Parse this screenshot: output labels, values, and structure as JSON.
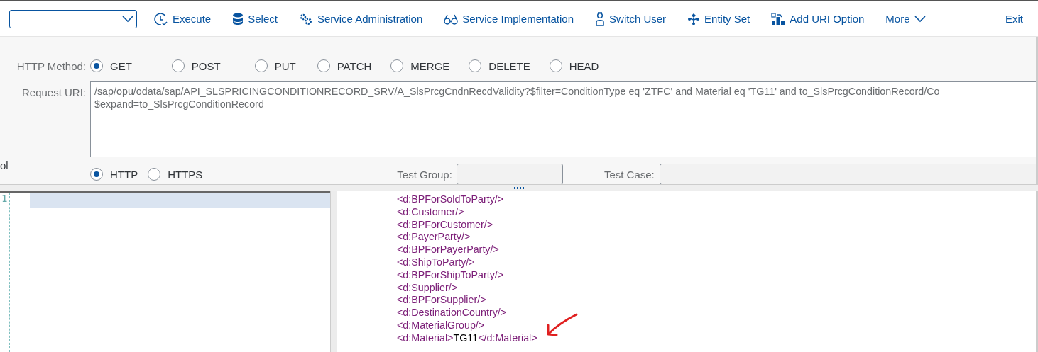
{
  "toolbar": {
    "items": [
      {
        "label": "Execute",
        "kind": "clock"
      },
      {
        "label": "Select",
        "kind": "database"
      },
      {
        "label": "Service Administration",
        "kind": "gears"
      },
      {
        "label": "Service Implementation",
        "kind": "glasses"
      },
      {
        "label": "Switch User",
        "kind": "person"
      },
      {
        "label": "Entity Set",
        "kind": "hierarchy"
      },
      {
        "label": "Add URI Option",
        "kind": "blocks"
      },
      {
        "label": "More",
        "kind": "menu"
      },
      {
        "label": "Exit",
        "kind": "plain"
      }
    ]
  },
  "http_method": {
    "label": "HTTP Method:",
    "options": [
      {
        "label": "GET",
        "selected": true
      },
      {
        "label": "POST",
        "selected": false
      },
      {
        "label": "PUT",
        "selected": false
      },
      {
        "label": "PATCH",
        "selected": false
      },
      {
        "label": "MERGE",
        "selected": false
      },
      {
        "label": "DELETE",
        "selected": false
      },
      {
        "label": "HEAD",
        "selected": false
      }
    ]
  },
  "request_uri": {
    "label": "Request URI:",
    "lines": [
      "/sap/opu/odata/sap/API_SLSPRICINGCONDITIONRECORD_SRV/A_SlsPrcgCndnRecdValidity?$filter=ConditionType eq 'ZTFC' and Material eq 'TG11' and to_SlsPrcgConditionRecord/Co",
      "$expand=to_SlsPrcgConditionRecord"
    ]
  },
  "protocol": {
    "label": "ol",
    "options": [
      {
        "label": "HTTP",
        "selected": true
      },
      {
        "label": "HTTPS",
        "selected": false
      }
    ]
  },
  "test_group": {
    "label": "Test Group:"
  },
  "test_case": {
    "label": "Test Case:"
  },
  "request_editor": {
    "line_numbers": [
      "1"
    ]
  },
  "response": {
    "lines": [
      {
        "kind": "empty",
        "text": "<d:BPForSoldToParty/>"
      },
      {
        "kind": "empty",
        "text": "<d:Customer/>"
      },
      {
        "kind": "empty",
        "text": "<d:BPForCustomer/>"
      },
      {
        "kind": "empty",
        "text": "<d:PayerParty/>"
      },
      {
        "kind": "empty",
        "text": "<d:BPForPayerParty/>"
      },
      {
        "kind": "empty",
        "text": "<d:ShipToParty/>"
      },
      {
        "kind": "empty",
        "text": "<d:BPForShipToParty/>"
      },
      {
        "kind": "empty",
        "text": "<d:Supplier/>"
      },
      {
        "kind": "empty",
        "text": "<d:BPForSupplier/>"
      },
      {
        "kind": "empty",
        "text": "<d:DestinationCountry/>"
      },
      {
        "kind": "empty",
        "text": "<d:MaterialGroup/>"
      },
      {
        "kind": "element",
        "open": "<d:Material>",
        "value": "TG11",
        "close": "</d:Material>",
        "annotated": true
      }
    ]
  }
}
